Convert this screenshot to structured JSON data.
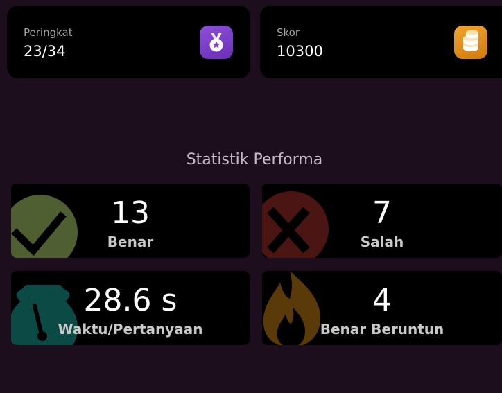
{
  "summary": {
    "rank": {
      "label": "Peringkat",
      "value": "23/34",
      "icon": "medal-icon",
      "color": "#7b3fc8"
    },
    "score": {
      "label": "Skor",
      "value": "10300",
      "icon": "coins-icon",
      "color": "#e8951f"
    }
  },
  "stats": {
    "title": "Statistik Performa",
    "items": [
      {
        "value": "13",
        "label": "Benar",
        "icon": "check-icon",
        "color": "#4f5f32"
      },
      {
        "value": "7",
        "label": "Salah",
        "icon": "cross-icon",
        "color": "#4a1512"
      },
      {
        "value": "28.6 s",
        "label": "Waktu/Pertanyaan",
        "icon": "stopwatch-icon",
        "color": "#0c4a46"
      },
      {
        "value": "4",
        "label": "Benar Beruntun",
        "icon": "fire-icon",
        "color": "#5a3a08"
      }
    ]
  }
}
